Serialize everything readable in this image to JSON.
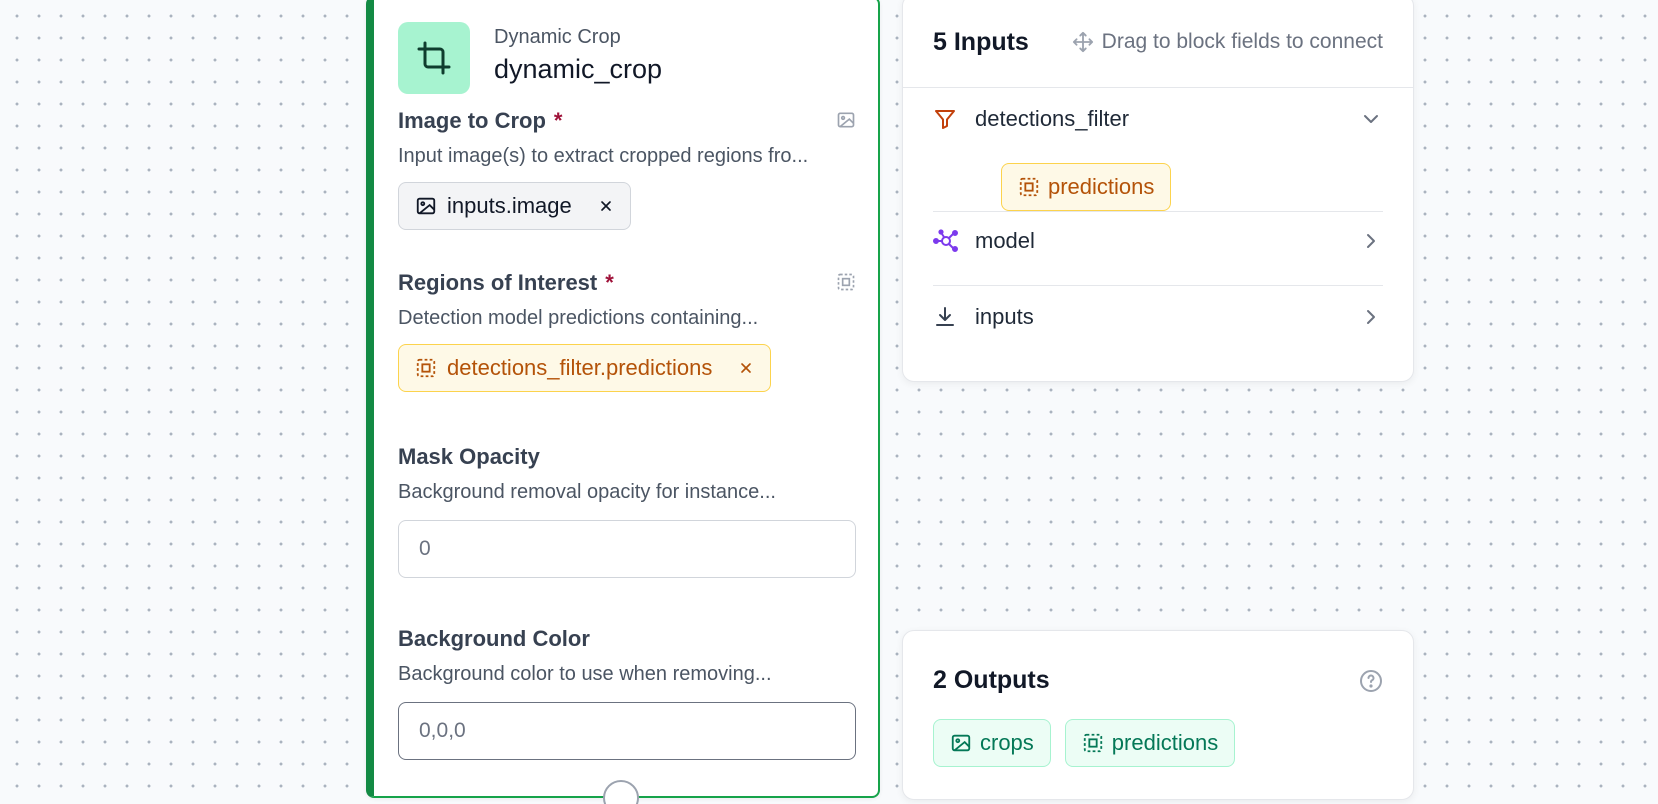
{
  "block": {
    "type_label": "Dynamic Crop",
    "name": "dynamic_crop",
    "icon": "crop-icon",
    "accent_color": "#16a34a",
    "icon_bg_color": "#a7f3d0",
    "fields": {
      "image": {
        "title": "Image to Crop",
        "required_mark": "*",
        "description": "Input image(s) to extract cropped regions fro...",
        "type_icon": "image-icon",
        "chip_label": "inputs.image",
        "chip_icon": "image-icon"
      },
      "regions": {
        "title": "Regions of Interest",
        "required_mark": "*",
        "description": "Detection model predictions containing...",
        "type_icon": "detection-icon",
        "chip_label": "detections_filter.predictions",
        "chip_icon": "detection-icon"
      },
      "mask_opacity": {
        "title": "Mask Opacity",
        "description": "Background removal opacity for instance...",
        "placeholder": "0"
      },
      "background_color": {
        "title": "Background Color",
        "description": "Background color to use when removing...",
        "placeholder": "0,0,0"
      }
    }
  },
  "inputs_panel": {
    "title": "5 Inputs",
    "hint": "Drag to block fields to connect",
    "hint_icon": "move-icon",
    "items": [
      {
        "label": "detections_filter",
        "icon": "filter-icon",
        "icon_color": "#c2410c",
        "expanded": true,
        "sub_items": [
          "predictions"
        ]
      },
      {
        "label": "model",
        "icon": "model-graph-icon",
        "icon_color": "#7c3aed",
        "expanded": false
      },
      {
        "label": "inputs",
        "icon": "download-icon",
        "icon_color": "#374151",
        "expanded": false
      }
    ]
  },
  "outputs_panel": {
    "title": "2 Outputs",
    "help_icon": "question-icon",
    "items": [
      {
        "label": "crops",
        "icon": "image-icon"
      },
      {
        "label": "predictions",
        "icon": "detection-icon"
      }
    ]
  },
  "colors": {
    "required": "#9f1239",
    "amber_text": "#b45309",
    "green_text": "#047857"
  }
}
